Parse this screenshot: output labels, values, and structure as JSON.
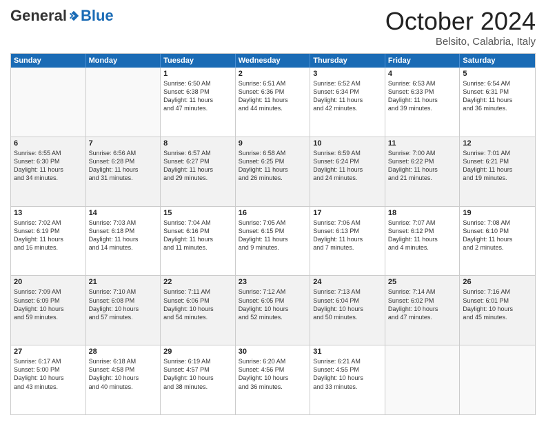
{
  "logo": {
    "general": "General",
    "blue": "Blue"
  },
  "title": "October 2024",
  "location": "Belsito, Calabria, Italy",
  "days": [
    "Sunday",
    "Monday",
    "Tuesday",
    "Wednesday",
    "Thursday",
    "Friday",
    "Saturday"
  ],
  "rows": [
    [
      {
        "day": "",
        "text": ""
      },
      {
        "day": "",
        "text": ""
      },
      {
        "day": "1",
        "text": "Sunrise: 6:50 AM\nSunset: 6:38 PM\nDaylight: 11 hours\nand 47 minutes."
      },
      {
        "day": "2",
        "text": "Sunrise: 6:51 AM\nSunset: 6:36 PM\nDaylight: 11 hours\nand 44 minutes."
      },
      {
        "day": "3",
        "text": "Sunrise: 6:52 AM\nSunset: 6:34 PM\nDaylight: 11 hours\nand 42 minutes."
      },
      {
        "day": "4",
        "text": "Sunrise: 6:53 AM\nSunset: 6:33 PM\nDaylight: 11 hours\nand 39 minutes."
      },
      {
        "day": "5",
        "text": "Sunrise: 6:54 AM\nSunset: 6:31 PM\nDaylight: 11 hours\nand 36 minutes."
      }
    ],
    [
      {
        "day": "6",
        "text": "Sunrise: 6:55 AM\nSunset: 6:30 PM\nDaylight: 11 hours\nand 34 minutes."
      },
      {
        "day": "7",
        "text": "Sunrise: 6:56 AM\nSunset: 6:28 PM\nDaylight: 11 hours\nand 31 minutes."
      },
      {
        "day": "8",
        "text": "Sunrise: 6:57 AM\nSunset: 6:27 PM\nDaylight: 11 hours\nand 29 minutes."
      },
      {
        "day": "9",
        "text": "Sunrise: 6:58 AM\nSunset: 6:25 PM\nDaylight: 11 hours\nand 26 minutes."
      },
      {
        "day": "10",
        "text": "Sunrise: 6:59 AM\nSunset: 6:24 PM\nDaylight: 11 hours\nand 24 minutes."
      },
      {
        "day": "11",
        "text": "Sunrise: 7:00 AM\nSunset: 6:22 PM\nDaylight: 11 hours\nand 21 minutes."
      },
      {
        "day": "12",
        "text": "Sunrise: 7:01 AM\nSunset: 6:21 PM\nDaylight: 11 hours\nand 19 minutes."
      }
    ],
    [
      {
        "day": "13",
        "text": "Sunrise: 7:02 AM\nSunset: 6:19 PM\nDaylight: 11 hours\nand 16 minutes."
      },
      {
        "day": "14",
        "text": "Sunrise: 7:03 AM\nSunset: 6:18 PM\nDaylight: 11 hours\nand 14 minutes."
      },
      {
        "day": "15",
        "text": "Sunrise: 7:04 AM\nSunset: 6:16 PM\nDaylight: 11 hours\nand 11 minutes."
      },
      {
        "day": "16",
        "text": "Sunrise: 7:05 AM\nSunset: 6:15 PM\nDaylight: 11 hours\nand 9 minutes."
      },
      {
        "day": "17",
        "text": "Sunrise: 7:06 AM\nSunset: 6:13 PM\nDaylight: 11 hours\nand 7 minutes."
      },
      {
        "day": "18",
        "text": "Sunrise: 7:07 AM\nSunset: 6:12 PM\nDaylight: 11 hours\nand 4 minutes."
      },
      {
        "day": "19",
        "text": "Sunrise: 7:08 AM\nSunset: 6:10 PM\nDaylight: 11 hours\nand 2 minutes."
      }
    ],
    [
      {
        "day": "20",
        "text": "Sunrise: 7:09 AM\nSunset: 6:09 PM\nDaylight: 10 hours\nand 59 minutes."
      },
      {
        "day": "21",
        "text": "Sunrise: 7:10 AM\nSunset: 6:08 PM\nDaylight: 10 hours\nand 57 minutes."
      },
      {
        "day": "22",
        "text": "Sunrise: 7:11 AM\nSunset: 6:06 PM\nDaylight: 10 hours\nand 54 minutes."
      },
      {
        "day": "23",
        "text": "Sunrise: 7:12 AM\nSunset: 6:05 PM\nDaylight: 10 hours\nand 52 minutes."
      },
      {
        "day": "24",
        "text": "Sunrise: 7:13 AM\nSunset: 6:04 PM\nDaylight: 10 hours\nand 50 minutes."
      },
      {
        "day": "25",
        "text": "Sunrise: 7:14 AM\nSunset: 6:02 PM\nDaylight: 10 hours\nand 47 minutes."
      },
      {
        "day": "26",
        "text": "Sunrise: 7:16 AM\nSunset: 6:01 PM\nDaylight: 10 hours\nand 45 minutes."
      }
    ],
    [
      {
        "day": "27",
        "text": "Sunrise: 6:17 AM\nSunset: 5:00 PM\nDaylight: 10 hours\nand 43 minutes."
      },
      {
        "day": "28",
        "text": "Sunrise: 6:18 AM\nSunset: 4:58 PM\nDaylight: 10 hours\nand 40 minutes."
      },
      {
        "day": "29",
        "text": "Sunrise: 6:19 AM\nSunset: 4:57 PM\nDaylight: 10 hours\nand 38 minutes."
      },
      {
        "day": "30",
        "text": "Sunrise: 6:20 AM\nSunset: 4:56 PM\nDaylight: 10 hours\nand 36 minutes."
      },
      {
        "day": "31",
        "text": "Sunrise: 6:21 AM\nSunset: 4:55 PM\nDaylight: 10 hours\nand 33 minutes."
      },
      {
        "day": "",
        "text": ""
      },
      {
        "day": "",
        "text": ""
      }
    ]
  ]
}
